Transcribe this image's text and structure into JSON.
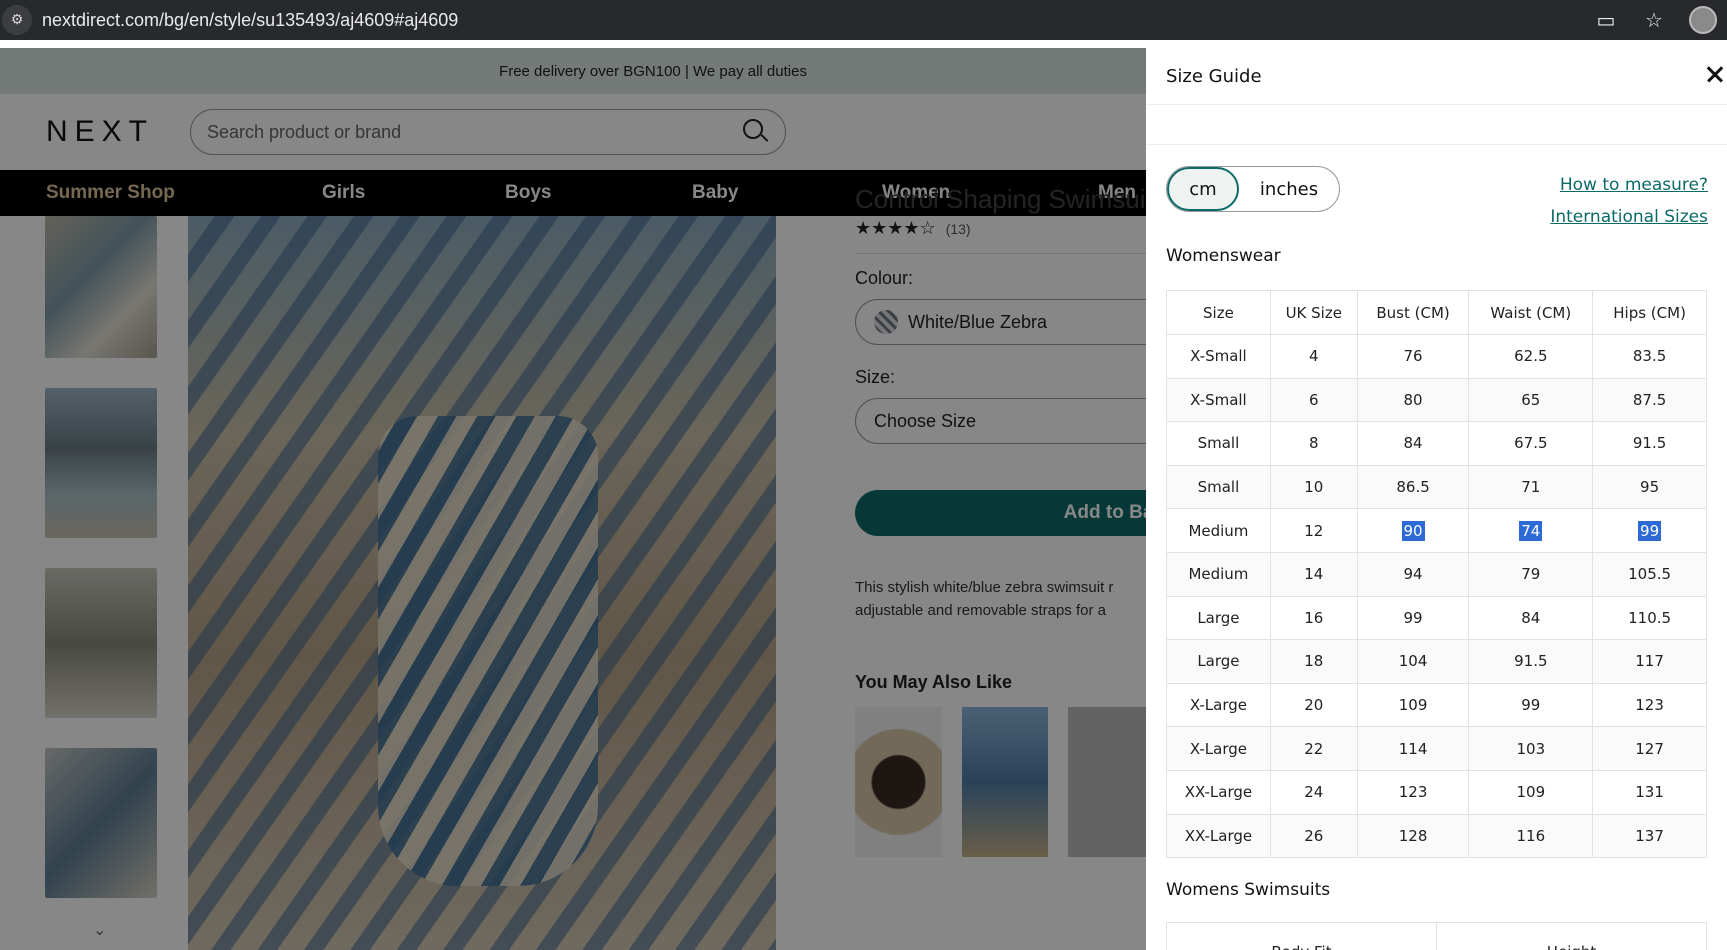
{
  "browser": {
    "url": "nextdirect.com/bg/en/style/su135493/aj4609#aj4609"
  },
  "page": {
    "promo_text": "Free delivery over BGN100 | We pay all duties",
    "logo": "NEXT",
    "search_placeholder": "Search product or brand",
    "nav": [
      "Summer Shop",
      "Girls",
      "Boys",
      "Baby",
      "Women",
      "Men"
    ],
    "product": {
      "title_fragment": "Control Shaping Swimsuit",
      "rating_stars": "★★★★☆",
      "review_count": "(13)",
      "colour_label": "Colour:",
      "colour_value": "White/Blue Zebra",
      "size_label": "Size:",
      "size_placeholder": "Choose Size",
      "add_to_bag": "Add to Bag",
      "description_line1": "This stylish white/blue zebra swimsuit r",
      "description_line2": "adjustable and removable straps for a",
      "also_like": "You May Also Like"
    }
  },
  "size_guide": {
    "title": "Size Guide",
    "units": [
      "cm",
      "inches"
    ],
    "selected_unit": "cm",
    "links": [
      "How to measure?",
      "International Sizes"
    ],
    "section_womenswear": "Womenswear",
    "columns": [
      "Size",
      "UK Size",
      "Bust (CM)",
      "Waist (CM)",
      "Hips (CM)"
    ],
    "rows": [
      [
        "X-Small",
        "4",
        "76",
        "62.5",
        "83.5"
      ],
      [
        "X-Small",
        "6",
        "80",
        "65",
        "87.5"
      ],
      [
        "Small",
        "8",
        "84",
        "67.5",
        "91.5"
      ],
      [
        "Small",
        "10",
        "86.5",
        "71",
        "95"
      ],
      [
        "Medium",
        "12",
        "90",
        "74",
        "99"
      ],
      [
        "Medium",
        "14",
        "94",
        "79",
        "105.5"
      ],
      [
        "Large",
        "16",
        "99",
        "84",
        "110.5"
      ],
      [
        "Large",
        "18",
        "104",
        "91.5",
        "117"
      ],
      [
        "X-Large",
        "20",
        "109",
        "99",
        "123"
      ],
      [
        "X-Large",
        "22",
        "114",
        "103",
        "127"
      ],
      [
        "XX-Large",
        "24",
        "123",
        "109",
        "131"
      ],
      [
        "XX-Large",
        "26",
        "128",
        "116",
        "137"
      ]
    ],
    "highlighted_row": 4,
    "section_swimsuits": "Womens Swimsuits",
    "swim_columns": [
      "Body Fit",
      "Height"
    ]
  },
  "colors": {
    "accent": "#0b6a68",
    "selection": "#2c6bd6",
    "nav_highlight": "#e0c79a"
  }
}
